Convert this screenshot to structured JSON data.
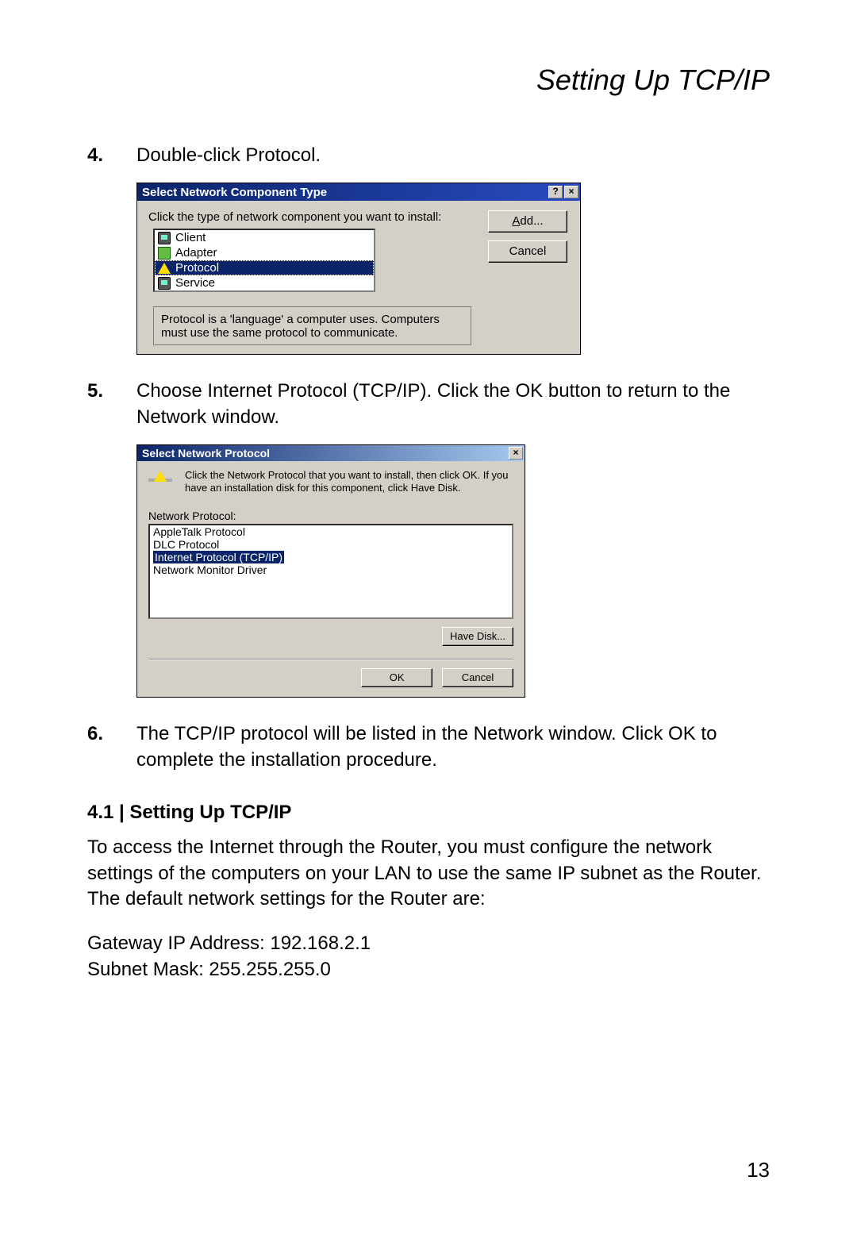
{
  "header": {
    "title": "Setting Up TCP/IP"
  },
  "steps": {
    "s4": {
      "num": "4.",
      "text": "Double-click Protocol."
    },
    "s5": {
      "num": "5.",
      "text": "Choose Internet Protocol (TCP/IP). Click the OK button to return to the Network window."
    },
    "s6": {
      "num": "6.",
      "text": "The TCP/IP protocol will be listed in the Network window. Click OK to complete the installation procedure."
    }
  },
  "dialog1": {
    "title": "Select Network Component Type",
    "help_btn": "?",
    "close_btn": "×",
    "instruction": "Click the type of network component you want to install:",
    "items": {
      "client": "Client",
      "adapter": "Adapter",
      "protocol": "Protocol",
      "service": "Service"
    },
    "add_prefix": "A",
    "add_rest": "dd...",
    "cancel": "Cancel",
    "desc": "Protocol is a 'language' a computer uses. Computers must use the same protocol to communicate."
  },
  "dialog2": {
    "title": "Select Network Protocol",
    "close_btn": "×",
    "toptext": "Click the Network Protocol that you want to install, then click OK. If you have an installation disk for this component, click Have Disk.",
    "list_label": "Network Protocol:",
    "items": {
      "appletalk": "AppleTalk Protocol",
      "dlc": "DLC Protocol",
      "tcpip": "Internet Protocol (TCP/IP)",
      "netmon": "Network Monitor Driver"
    },
    "have_disk": "Have Disk...",
    "ok": "OK",
    "cancel": "Cancel"
  },
  "section": {
    "heading": "4.1 | Setting Up TCP/IP",
    "p1": "To access the Internet through the Router, you must configure the network settings of the computers on your LAN to use the same IP subnet as the Router. The default network settings for the Router are:",
    "gateway": "Gateway IP Address: 192.168.2.1",
    "subnet": "Subnet Mask: 255.255.255.0"
  },
  "page_number": "13"
}
